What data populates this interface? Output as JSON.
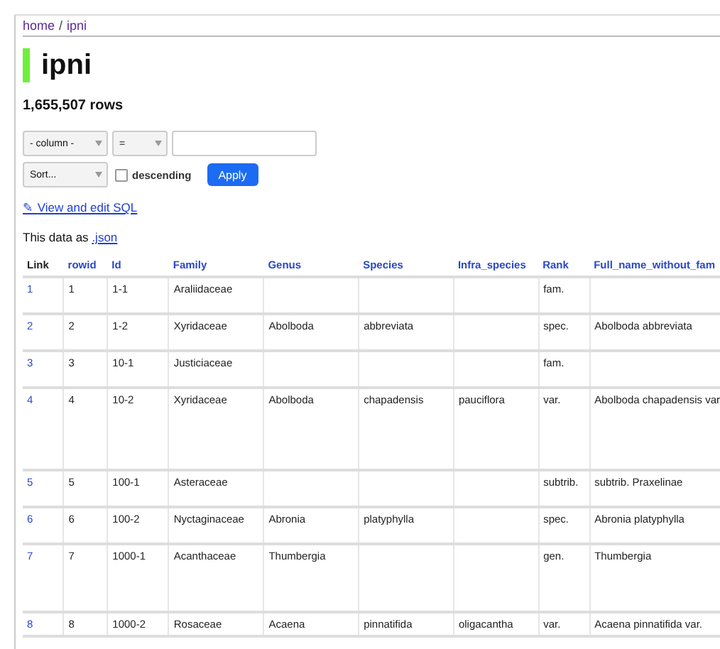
{
  "breadcrumb": [
    {
      "label": "home"
    },
    {
      "label": "ipni"
    }
  ],
  "breadcrumb_separator": "/",
  "title": "ipni",
  "row_count": "1,655,507 rows",
  "filter": {
    "column": "- column -",
    "operator": "="
  },
  "sort": {
    "label": "Sort...",
    "descending": false,
    "descending_label": "descending",
    "apply": "Apply"
  },
  "sql_link": {
    "icon": "✎",
    "label": "View and edit SQL"
  },
  "export": {
    "text": "This data as",
    "link": ".json"
  },
  "table": {
    "columns": [
      "Link",
      "rowid",
      "Id",
      "Family",
      "Genus",
      "Species",
      "Infra_species",
      "Rank",
      "Full_name_without_fam"
    ],
    "rows": [
      [
        "1",
        "1",
        "1-1",
        "Araliidaceae",
        "",
        "",
        "",
        "fam.",
        ""
      ],
      [
        "2",
        "2",
        "1-2",
        "Xyridaceae",
        "Abolboda",
        "abbreviata",
        "",
        "spec.",
        "Abolboda abbreviata"
      ],
      [
        "3",
        "3",
        "10-1",
        "Justiciaceae",
        "",
        "",
        "",
        "fam.",
        ""
      ],
      [
        "4",
        "4",
        "10-2",
        "Xyridaceae",
        "Abolboda",
        "chapadensis",
        "pauciflora",
        "var.",
        "Abolboda chapadensis var"
      ],
      [
        "5",
        "5",
        "100-1",
        "Asteraceae",
        "",
        "",
        "",
        "subtrib.",
        "subtrib. Praxelinae"
      ],
      [
        "6",
        "6",
        "100-2",
        "Nyctaginaceae",
        "Abronia",
        "platyphylla",
        "",
        "spec.",
        "Abronia platyphylla"
      ],
      [
        "7",
        "7",
        "1000-1",
        "Acanthaceae",
        "Thumbergia",
        "",
        "",
        "gen.",
        "Thumbergia"
      ],
      [
        "8",
        "8",
        "1000-2",
        "Rosaceae",
        "Acaena",
        "pinnatifida",
        "oligacantha",
        "var.",
        "Acaena pinnatifida var."
      ]
    ]
  }
}
